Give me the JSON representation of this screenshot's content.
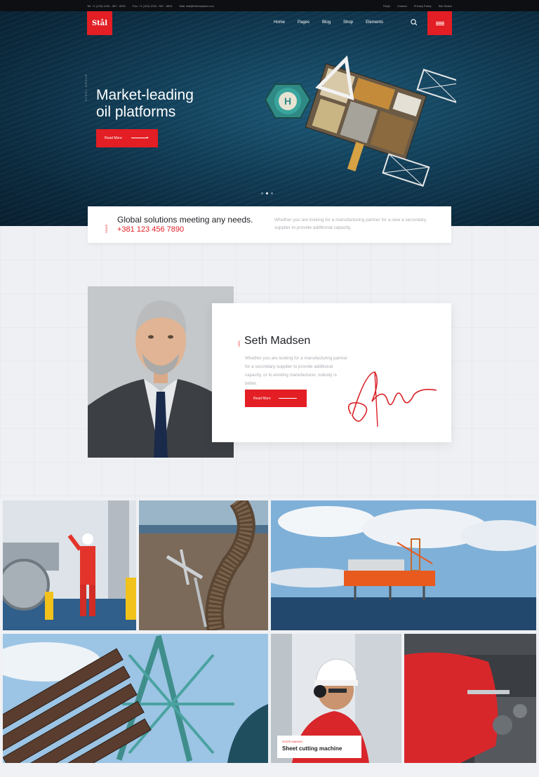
{
  "topbar": {
    "phone": "Tel: +1 (123) 1234 - 567 - 8901",
    "fax": "Fax: +1 (123) 1234 - 567 - 8901",
    "email": "Mail: stal@themeplace.com",
    "links": [
      "FAQs",
      "Contact",
      "Privacy Policy",
      "Site Notice"
    ]
  },
  "header": {
    "logo": "Stål",
    "nav": [
      "Home",
      "Pages",
      "Blog",
      "Shop",
      "Elements"
    ]
  },
  "hero": {
    "side_label": "STEEL GROUP",
    "title_line1": "Market-leading",
    "title_line2": "oil platforms",
    "button": "Read More",
    "slides": 3,
    "active_slide": 2
  },
  "info": {
    "side_label": "SINCE",
    "title": "Global solutions meeting any needs.",
    "phone": "+381 123 456 7890",
    "text": "Whether you are looking for a manufacturing partner for a new a secondary supplier to provide additional capacity."
  },
  "profile": {
    "side_label": "CEO",
    "name": "Seth Madsen",
    "bio": "Whether you are looking for a manufacturing partner for a secondary supplier to provide additional capacity, or to existing manufacturer, nobody is better.",
    "button": "Read More"
  },
  "gallery": {
    "caption_category": "STATE MAKING",
    "caption_title": "Sheet cutting machine"
  },
  "colors": {
    "accent": "#e31e24",
    "dark": "#0d0f12",
    "ocean": "#123f59"
  }
}
